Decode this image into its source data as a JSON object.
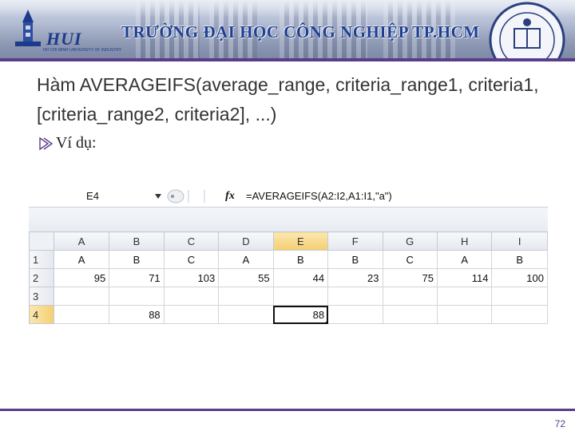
{
  "header": {
    "logo_text": "HUI",
    "logo_subtitle": "HO CHI MINH UNIVERSITY OF INDUSTRY",
    "school_name": "TRƯỜNG ĐẠI HỌC CÔNG NGHIỆP TP.HCM"
  },
  "slide": {
    "title": "Hàm AVERAGEIFS(average_range, criteria_range1, criteria1, [criteria_range2, criteria2], ...)",
    "bullet_text": "Ví dụ:",
    "page_number": "72"
  },
  "excel": {
    "name_box": "E4",
    "fx_label": "fx",
    "formula": "=AVERAGEIFS(A2:I2,A1:I1,\"a\")",
    "columns": [
      "A",
      "B",
      "C",
      "D",
      "E",
      "F",
      "G",
      "H",
      "I"
    ],
    "active_column": "E",
    "active_row": "4",
    "rows": [
      {
        "label": "1",
        "cells": [
          "A",
          "B",
          "C",
          "A",
          "B",
          "B",
          "C",
          "A",
          "B"
        ]
      },
      {
        "label": "2",
        "cells": [
          "95",
          "71",
          "103",
          "55",
          "44",
          "23",
          "75",
          "114",
          "100"
        ]
      },
      {
        "label": "3",
        "cells": [
          "",
          "",
          "",
          "",
          "",
          "",
          "",
          "",
          ""
        ]
      },
      {
        "label": "4",
        "cells": [
          "",
          "88",
          "",
          "",
          "88",
          "",
          "",
          "",
          ""
        ]
      }
    ]
  },
  "colors": {
    "accent": "#5a3d8a",
    "title_text": "#333333",
    "header_blue": "#1f3f8f"
  }
}
